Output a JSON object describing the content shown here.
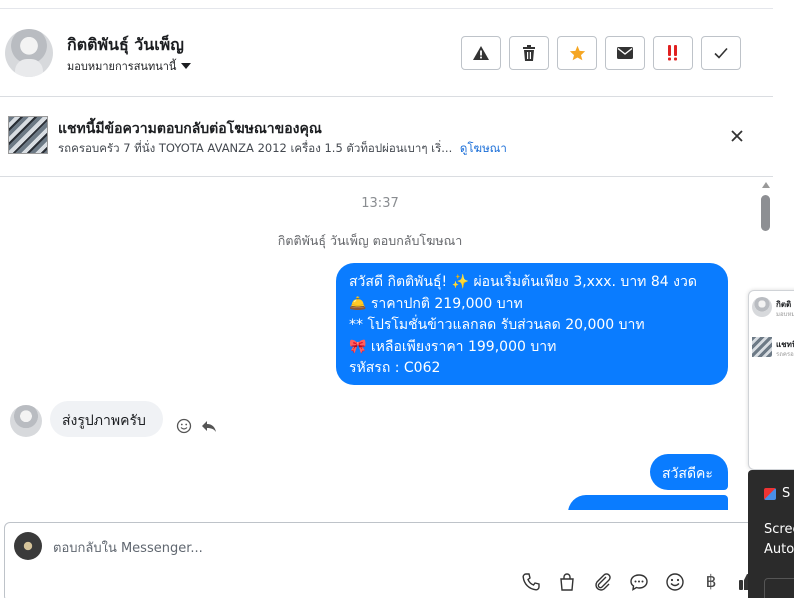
{
  "header": {
    "contact_name": "กิตติพันธุ์ วันเพ็ญ",
    "assign_label": "มอบหมายการสนทนานี้",
    "actions": [
      {
        "icon": "warning-icon",
        "label": "!"
      },
      {
        "icon": "trash-icon",
        "label": ""
      },
      {
        "icon": "star-icon",
        "label": ""
      },
      {
        "icon": "envelope-icon",
        "label": ""
      },
      {
        "icon": "priority-icon",
        "label": "‼"
      },
      {
        "icon": "checkmark-icon",
        "label": ""
      }
    ],
    "colors": {
      "star": "#f5a623",
      "priority": "#e02020"
    }
  },
  "ad_banner": {
    "title": "แชทนี้มีข้อความตอบกลับต่อโฆษณาของคุณ",
    "subtitle": "รถครอบครัว 7 ที่นั่ง TOYOTA AVANZA 2012 เครื่อง 1.5 ตัวท็อปผ่อนเบาๆ เริ่...",
    "link": "ดูโฆษณา"
  },
  "thread": {
    "time": "13:37",
    "replied_note": "กิตติพันธุ์ วันเพ็ญ ตอบกลับโฆษณา",
    "outgoing_ad_message": [
      "สวัสดี กิตติพันธุ์! ✨  ผ่อนเริ่มต้นเพียง 3,xxx. บาท 84 งวด",
      "🛎️ ราคาปกติ 219,000 บาท",
      "** โปรโมชั่นข้าวแลกลด รับส่วนลด 20,000 บาท",
      "🎀  เหลือเพียงราคา 199,000 บาท",
      " รหัสรถ : C062"
    ],
    "incoming_message": "ส่งรูปภาพครับ",
    "outgoing_reply_1": "สวัสดีคะ",
    "outgoing_reply_2": "",
    "bubble_color": "#0a7cff"
  },
  "composer": {
    "placeholder": "ตอบกลับใน Messenger...",
    "tools": [
      "phone-icon",
      "shopping-bag-icon",
      "paperclip-icon",
      "chat-bubble-icon",
      "emoji-icon",
      "baht-icon",
      "thumbs-up-icon"
    ],
    "baht_symbol": "฿"
  },
  "side_panel": {
    "items": [
      {
        "name": "กิตติ",
        "sub": "มอบหมาย"
      },
      {
        "name": "แชทนี้",
        "sub": "รถครอบครัว"
      }
    ]
  },
  "popup": {
    "head": "S",
    "line1": "Scree",
    "line2": "Auto"
  }
}
